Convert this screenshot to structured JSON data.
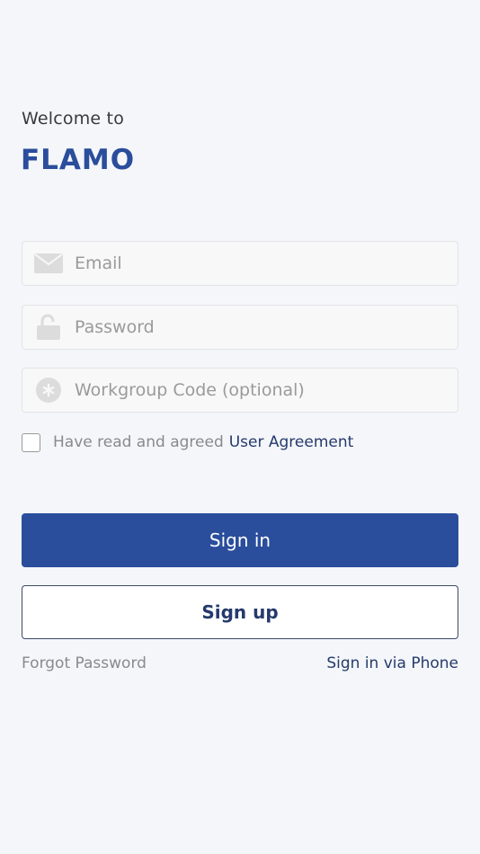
{
  "header": {
    "welcome": "Welcome to",
    "brand": "FLAMO"
  },
  "form": {
    "email": {
      "placeholder": "Email",
      "value": "",
      "icon": "mail-icon"
    },
    "password": {
      "placeholder": "Password",
      "value": "",
      "icon": "lock-icon"
    },
    "workgroup": {
      "placeholder": "Workgroup Code (optional)",
      "value": "",
      "icon": "asterisk-icon"
    },
    "agreement": {
      "checked": false,
      "text": "Have read and agreed",
      "link": "User Agreement"
    }
  },
  "actions": {
    "sign_in": "Sign in",
    "sign_up": "Sign up",
    "forgot_password": "Forgot Password",
    "sign_in_phone": "Sign in via Phone"
  },
  "colors": {
    "background": "#f4f6fa",
    "brand": "#2a4d9c",
    "link": "#253a6b",
    "muted": "#8a8a8a"
  }
}
